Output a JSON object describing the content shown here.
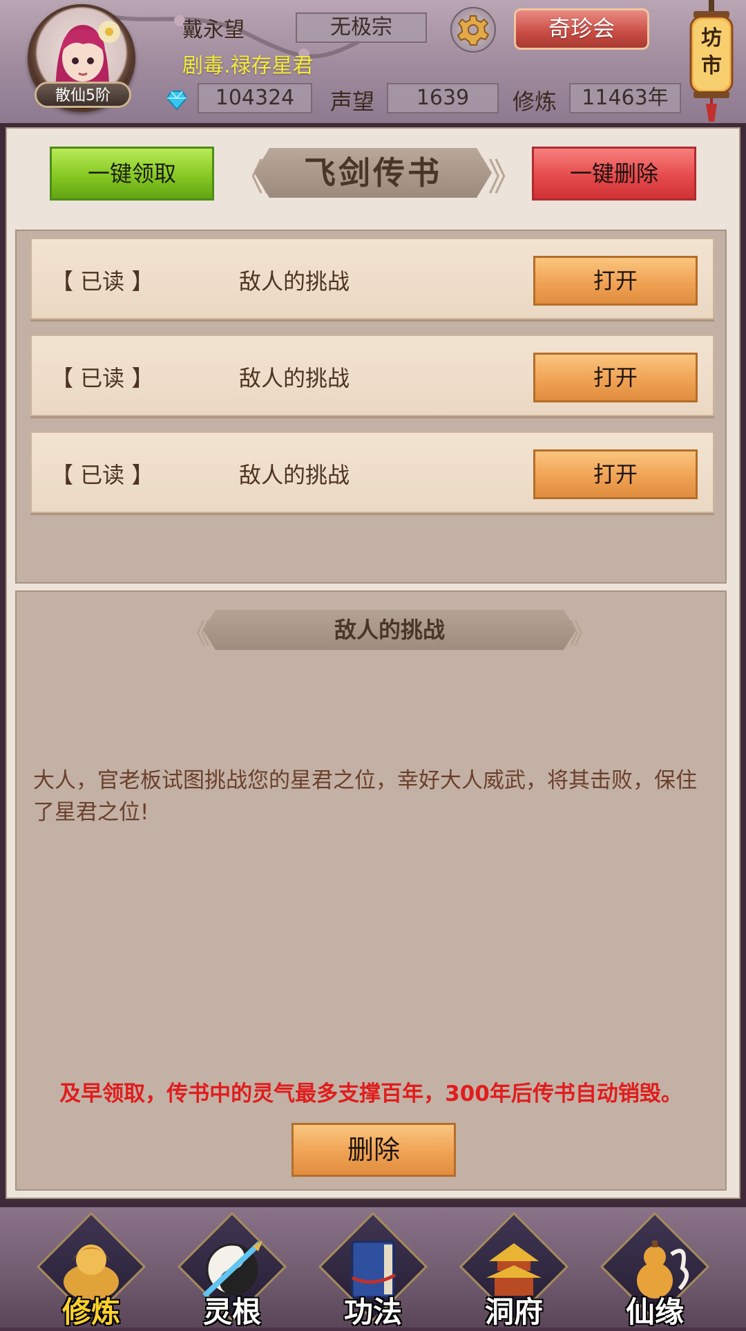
{
  "header": {
    "avatar_rank": "散仙5阶",
    "player_name": "戴永望",
    "player_title": "剧毒.禄存星君",
    "sect": "无极宗",
    "qizhen_button": "奇珍会",
    "lantern_text": "坊市",
    "spirit_stones": "104324",
    "reputation_label": "声望",
    "reputation": "1639",
    "cultivation_label": "修炼",
    "cultivation": "11463年",
    "icons": {
      "settings": "gear-icon",
      "currency": "blue-gem-icon",
      "market": "lantern-icon"
    }
  },
  "panel": {
    "title": "飞剑传书",
    "claim_all": "一键领取",
    "delete_all": "一键删除",
    "mails": [
      {
        "status": "【 已读 】",
        "subject": "敌人的挑战",
        "action": "打开"
      },
      {
        "status": "【 已读 】",
        "subject": "敌人的挑战",
        "action": "打开"
      },
      {
        "status": "【 已读 】",
        "subject": "敌人的挑战",
        "action": "打开"
      }
    ],
    "detail": {
      "title": "敌人的挑战",
      "body": "大人，官老板试图挑战您的星君之位，幸好大人威武，将其击败，保住了星君之位!",
      "warning": "及早领取，传书中的灵气最多支撑百年，300年后传书自动销毁。",
      "delete_button": "删除"
    }
  },
  "bottom_nav": {
    "items": [
      {
        "label": "修炼",
        "icon": "meditating-monk-icon",
        "active": true
      },
      {
        "label": "灵根",
        "icon": "yin-yang-sword-icon",
        "active": false
      },
      {
        "label": "功法",
        "icon": "book-icon",
        "active": false
      },
      {
        "label": "洞府",
        "icon": "pagoda-icon",
        "active": false
      },
      {
        "label": "仙缘",
        "icon": "gourd-icon",
        "active": false
      }
    ]
  },
  "colors": {
    "active_nav": "#ffd12c",
    "warning_text": "#e01c1c",
    "title_text": "#f4ea3a",
    "claim_button": "#86c924",
    "delete_all_button": "#e64b4c",
    "open_button": "#f0a254"
  }
}
